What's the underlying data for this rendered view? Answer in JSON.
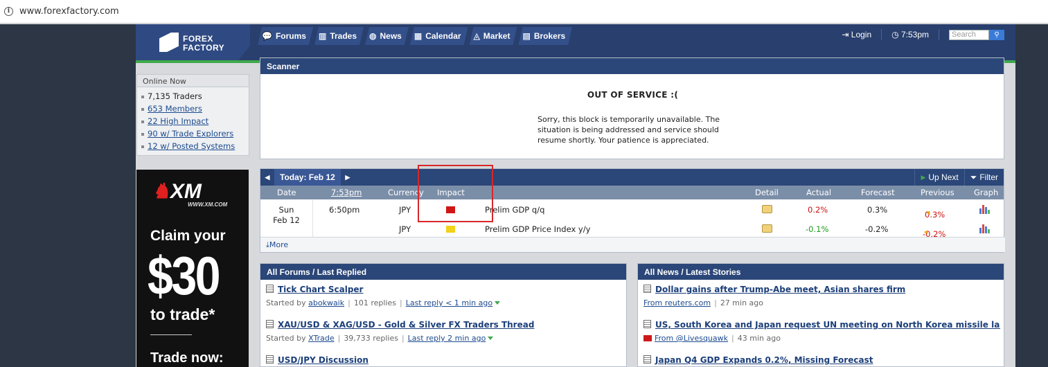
{
  "browser": {
    "url": "www.forexfactory.com"
  },
  "logo": {
    "line1": "FOREX",
    "line2": "FACTORY"
  },
  "nav": [
    {
      "label": "Forums",
      "icon": "💬"
    },
    {
      "label": "Trades",
      "icon": "▥"
    },
    {
      "label": "News",
      "icon": "◍"
    },
    {
      "label": "Calendar",
      "icon": "▦"
    },
    {
      "label": "Market",
      "icon": "◬"
    },
    {
      "label": "Brokers",
      "icon": "▤"
    }
  ],
  "header": {
    "login": "Login",
    "time": "7:53pm",
    "search_placeholder": "Search"
  },
  "online": {
    "title": "Online Now",
    "items": [
      "7,135 Traders",
      "653 Members",
      "22 High Impact",
      "90 w/ Trade Explorers",
      "12 w/ Posted Systems"
    ]
  },
  "ad": {
    "brand": "XM",
    "site": "WWW.XM.COM",
    "claim": "Claim your",
    "amount": "$30",
    "to_trade": "to trade*",
    "now": "Trade now:"
  },
  "scanner": {
    "title": "Scanner",
    "heading": "OUT OF SERVICE :(",
    "message": "Sorry, this block is temporarily unavailable. The situation is being addressed and service should resume shortly. Your patience is appreciated."
  },
  "calendar": {
    "today": "Today: Feb 12",
    "up_next": "Up Next",
    "filter": "Filter",
    "columns": {
      "date": "Date",
      "time": "7:53pm",
      "currency": "Currency",
      "impact": "Impact",
      "detail": "Detail",
      "actual": "Actual",
      "forecast": "Forecast",
      "previous": "Previous",
      "graph": "Graph"
    },
    "date_day": "Sun",
    "date_md": "Feb 12",
    "rows": [
      {
        "time": "6:50pm",
        "currency": "JPY",
        "impact_color": "#d01616",
        "event": "Prelim GDP q/q",
        "actual": "0.2%",
        "actual_color": "#cc1111",
        "forecast": "0.3%",
        "previous": "0.3%"
      },
      {
        "time": "",
        "currency": "JPY",
        "impact_color": "#f2d21a",
        "event": "Prelim GDP Price Index y/y",
        "actual": "-0.1%",
        "actual_color": "#1c9a1c",
        "forecast": "-0.2%",
        "previous": "-0.2%"
      }
    ],
    "more": "More"
  },
  "forums": {
    "title": "All Forums / Last Replied",
    "items": [
      {
        "title": "Tick Chart Scalper",
        "started_by": "Started by",
        "author": "abokwaik",
        "replies": "101 replies",
        "last": "Last reply < 1 min ago"
      },
      {
        "title": "XAU/USD & XAG/USD - Gold & Silver FX Traders Thread",
        "started_by": "Started by",
        "author": "XTrade",
        "replies": "39,733 replies",
        "last": "Last reply 2 min ago"
      },
      {
        "title": "USD/JPY Discussion"
      }
    ]
  },
  "news": {
    "title": "All News / Latest Stories",
    "items": [
      {
        "title": "Dollar gains after Trump-Abe meet, Asian shares firm",
        "source": "From reuters.com",
        "age": "27 min ago"
      },
      {
        "title": "US, South Korea and Japan request UN meeting on North Korea missile launch",
        "source": "From @Livesquawk",
        "age": "43 min ago"
      },
      {
        "title": "Japan Q4 GDP Expands 0.2%, Missing Forecast"
      }
    ]
  }
}
